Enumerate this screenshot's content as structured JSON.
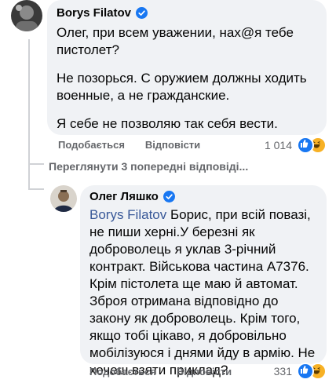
{
  "comment1": {
    "author": "Borys Filatov",
    "paragraphs": [
      "Олег, при всем уважении, нах@я тебе пистолет?",
      "Не позорься. С оружием должны ходить военные, а не гражданские.",
      "Я себе не позволяю так себя вести."
    ],
    "like_label": "Подобається",
    "reply_label": "Відповісти",
    "reaction_count": "1 014"
  },
  "view_previous": "Переглянути 3 попередні відповіді...",
  "comment2": {
    "author": "Олег Ляшко",
    "mention": "Borys Filatov",
    "text": " Борис, при всій повазі, не пиши херні.У березні як доброволець я уклав 3-річний контракт. Військова частина А7376. Крім пістолета ще маю й автомат. Зброя отримана відповідно до закону як доброволець. Крім того, якщо тобі цікаво, я добровільно мобілізуюся і днями йду в армію. Не хочеш взяти приклад?",
    "like_label": "Подобається",
    "reply_label": "Відповісти",
    "reaction_count": "331"
  },
  "colors": {
    "bubble": "#f0f2f5",
    "verified": "#1877f2",
    "mention": "#385898",
    "meta": "#65676b"
  }
}
